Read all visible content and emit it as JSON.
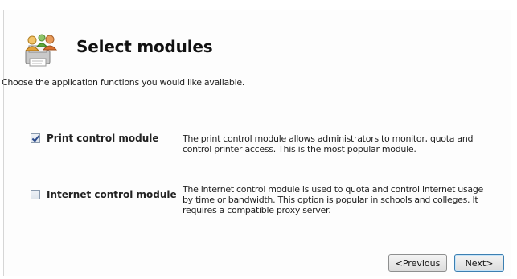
{
  "header": {
    "title": "Select modules",
    "subtitle": "Choose the application functions you would like available.",
    "icon": "printer-users-icon"
  },
  "modules": [
    {
      "label": "Print control module",
      "checked": true,
      "description": "The print control module allows administrators to monitor, quota and control printer access. This is the most popular module."
    },
    {
      "label": "Internet control module",
      "checked": false,
      "description": "The internet control module is used to quota and control internet usage by time or bandwidth. This option is popular in schools and colleges. It requires a compatible proxy server."
    }
  ],
  "footer": {
    "previous_label": "<Previous",
    "next_label": "Next>"
  }
}
